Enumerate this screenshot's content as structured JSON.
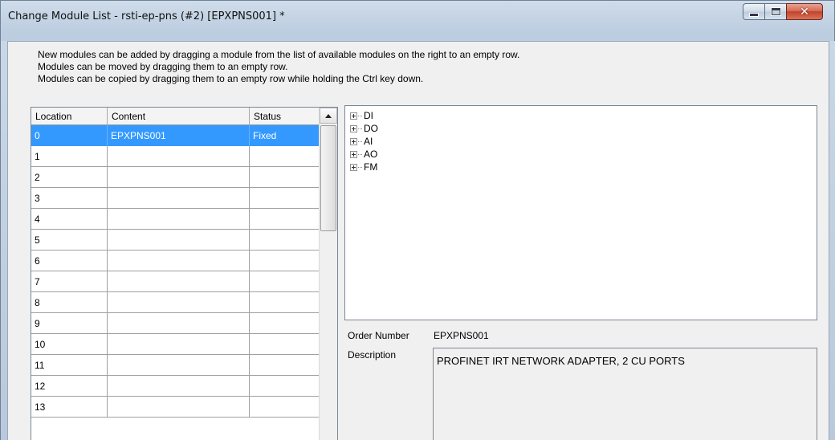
{
  "window": {
    "title": "Change Module List - rsti-ep-pns (#2) [EPXPNS001] *",
    "controls": {
      "minimize": "minimize-icon",
      "maximize": "maximize-icon",
      "close": "close-icon"
    }
  },
  "instructions": [
    "New modules can be added by dragging a module from the list of available modules on the right to an empty row.",
    "Modules can be moved by dragging them to an empty row.",
    "Modules can be copied by dragging them to an empty row while holding the Ctrl key down."
  ],
  "grid": {
    "columns": [
      "Location",
      "Content",
      "Status"
    ],
    "rows": [
      {
        "location": "0",
        "content": "EPXPNS001",
        "status": "Fixed",
        "selected": true
      },
      {
        "location": "1",
        "content": "",
        "status": ""
      },
      {
        "location": "2",
        "content": "",
        "status": ""
      },
      {
        "location": "3",
        "content": "",
        "status": ""
      },
      {
        "location": "4",
        "content": "",
        "status": ""
      },
      {
        "location": "5",
        "content": "",
        "status": ""
      },
      {
        "location": "6",
        "content": "",
        "status": ""
      },
      {
        "location": "7",
        "content": "",
        "status": ""
      },
      {
        "location": "8",
        "content": "",
        "status": ""
      },
      {
        "location": "9",
        "content": "",
        "status": ""
      },
      {
        "location": "10",
        "content": "",
        "status": ""
      },
      {
        "location": "11",
        "content": "",
        "status": ""
      },
      {
        "location": "12",
        "content": "",
        "status": ""
      },
      {
        "location": "13",
        "content": "",
        "status": ""
      }
    ]
  },
  "tree": {
    "items": [
      "DI",
      "DO",
      "AI",
      "AO",
      "FM"
    ]
  },
  "details": {
    "order_number_label": "Order Number",
    "order_number": "EPXPNS001",
    "description_label": "Description",
    "description": "PROFINET IRT NETWORK ADAPTER, 2 CU PORTS"
  },
  "colors": {
    "selection": "#3399ff",
    "close_button": "#c2432a"
  }
}
